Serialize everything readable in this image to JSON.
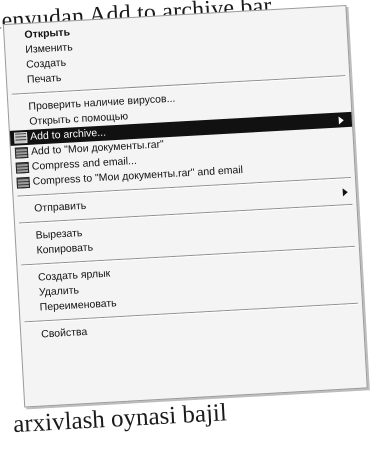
{
  "captions": {
    "top": "menyudan Add to archive bar",
    "bottom": "arxivlash oynasi bajil"
  },
  "menu": {
    "groups": [
      [
        {
          "label": "Открыть",
          "bold": true
        },
        {
          "label": "Изменить"
        },
        {
          "label": "Создать"
        },
        {
          "label": "Печать"
        }
      ],
      [
        {
          "label": "Проверить наличие вирусов..."
        },
        {
          "label": "Открыть с помощью"
        },
        {
          "label": "Add to archive...",
          "icon": "winrar-icon",
          "highlighted": true,
          "submenu": true
        },
        {
          "label": "Add to \"Мои документы.rar\"",
          "icon": "winrar-icon"
        },
        {
          "label": "Compress and email...",
          "icon": "winrar-icon"
        },
        {
          "label": "Compress to \"Мои документы.rar\" and email",
          "icon": "winrar-icon"
        }
      ],
      [
        {
          "label": "Отправить",
          "submenu": true
        }
      ],
      [
        {
          "label": "Вырезать"
        },
        {
          "label": "Копировать"
        }
      ],
      [
        {
          "label": "Создать ярлык"
        },
        {
          "label": "Удалить"
        },
        {
          "label": "Переименовать"
        }
      ],
      [
        {
          "label": "Свойства"
        }
      ]
    ]
  }
}
